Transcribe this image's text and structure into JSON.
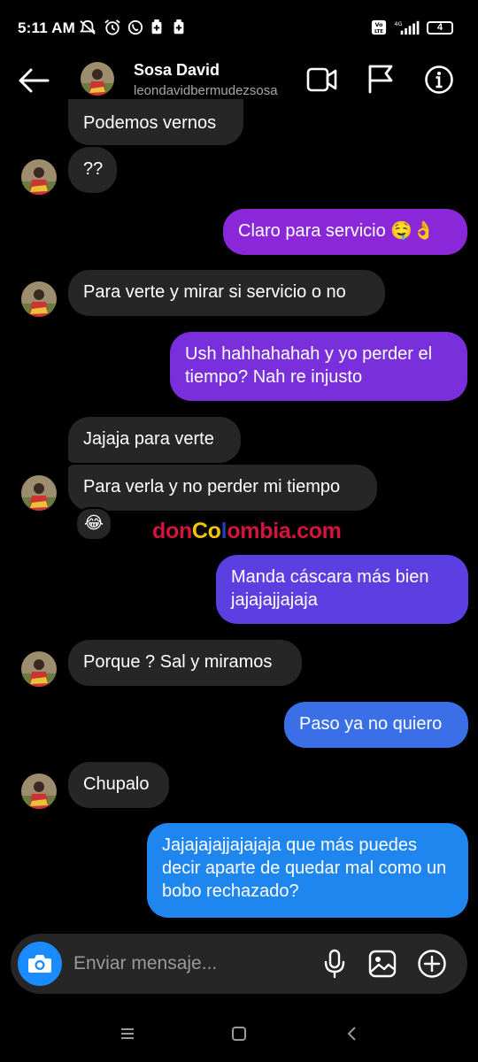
{
  "status_bar": {
    "time": "5:11 AM",
    "battery": "4",
    "network": "4G",
    "volte": "Vo LTE"
  },
  "header": {
    "name": "Sosa David",
    "username": "leondavidbermudezsosa",
    "icons": [
      "back-arrow-icon",
      "video-camera-icon",
      "flag-icon",
      "info-icon"
    ]
  },
  "messages": [
    {
      "side": "in",
      "text": "Podemos vernos"
    },
    {
      "side": "in",
      "text": "??"
    },
    {
      "side": "out",
      "text": "Claro para servicio 🤤👌"
    },
    {
      "side": "in",
      "text": "Para verte y mirar si servicio o no"
    },
    {
      "side": "out",
      "text": "Ush hahhahahah y yo perder el tiempo? Nah re injusto"
    },
    {
      "side": "in",
      "text": "Jajaja para verte"
    },
    {
      "side": "in",
      "text": "Para verla y no perder mi tiempo"
    },
    {
      "side": "out",
      "text": "Manda cáscara más bien jajajajjajaja"
    },
    {
      "side": "in",
      "text": "Porque ? Sal y miramos"
    },
    {
      "side": "out",
      "text": "Paso ya no quiero"
    },
    {
      "side": "in",
      "text": "Chupalo"
    },
    {
      "side": "out",
      "text": "Jajajajajjajajaja que más puedes decir aparte de quedar mal como un bobo rechazado?"
    }
  ],
  "reaction": "😂",
  "watermark": {
    "parts": [
      "don",
      "Co",
      "l",
      "o",
      "mbia",
      ".com"
    ],
    "colors": [
      "#d4143c",
      "#f5c400",
      "#1e3fb5",
      "#d4143c",
      "#d4143c",
      "#d4143c"
    ]
  },
  "composer": {
    "placeholder": "Enviar mensaje...",
    "icons": [
      "camera-icon",
      "microphone-icon",
      "gallery-icon",
      "add-circle-icon"
    ]
  },
  "nav_bar": {
    "icons": [
      "menu-icon",
      "home-square-icon",
      "back-chevron-icon"
    ]
  },
  "colors": {
    "incoming": "#262626",
    "outgoing_purple": "#8a28d9",
    "outgoing_indigo": "#5b3fe0",
    "outgoing_blue": "#3b6fe8",
    "outgoing_lightblue": "#1f86f0",
    "camera_blue": "#1a8cff"
  }
}
